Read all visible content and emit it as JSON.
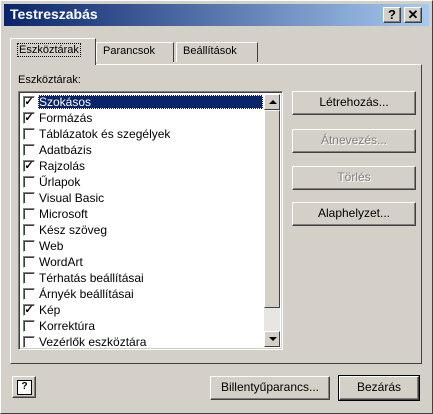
{
  "window": {
    "title": "Testreszabás"
  },
  "titlebar": {
    "help_glyph": "?",
    "close_glyph": "✕"
  },
  "tabs": [
    {
      "label": "Eszköztárak",
      "active": true
    },
    {
      "label": "Parancsok",
      "active": false
    },
    {
      "label": "Beállítások",
      "active": false
    }
  ],
  "list": {
    "label": "Eszköztárak:",
    "items": [
      {
        "label": "Szokásos",
        "checked": true,
        "selected": true
      },
      {
        "label": "Formázás",
        "checked": true
      },
      {
        "label": "Táblázatok és szegélyek",
        "checked": false
      },
      {
        "label": "Adatbázis",
        "checked": false
      },
      {
        "label": "Rajzolás",
        "checked": true
      },
      {
        "label": "Űrlapok",
        "checked": false
      },
      {
        "label": "Visual Basic",
        "checked": false
      },
      {
        "label": "Microsoft",
        "checked": false
      },
      {
        "label": "Kész szöveg",
        "checked": false
      },
      {
        "label": "Web",
        "checked": false
      },
      {
        "label": "WordArt",
        "checked": false
      },
      {
        "label": "Térhatás beállításai",
        "checked": false
      },
      {
        "label": "Árnyék beállításai",
        "checked": false
      },
      {
        "label": "Kép",
        "checked": true
      },
      {
        "label": "Korrektúra",
        "checked": false
      },
      {
        "label": "Vezérlők eszköztára",
        "checked": false
      }
    ],
    "check_glyph": "✓"
  },
  "side_buttons": {
    "create": "Létrehozás...",
    "rename": "Átnevezés...",
    "delete": "Törlés",
    "reset": "Alaphelyzet..."
  },
  "bottom": {
    "help_glyph": "?",
    "keyboard": "Billentyűparancs...",
    "close": "Bezárás"
  }
}
